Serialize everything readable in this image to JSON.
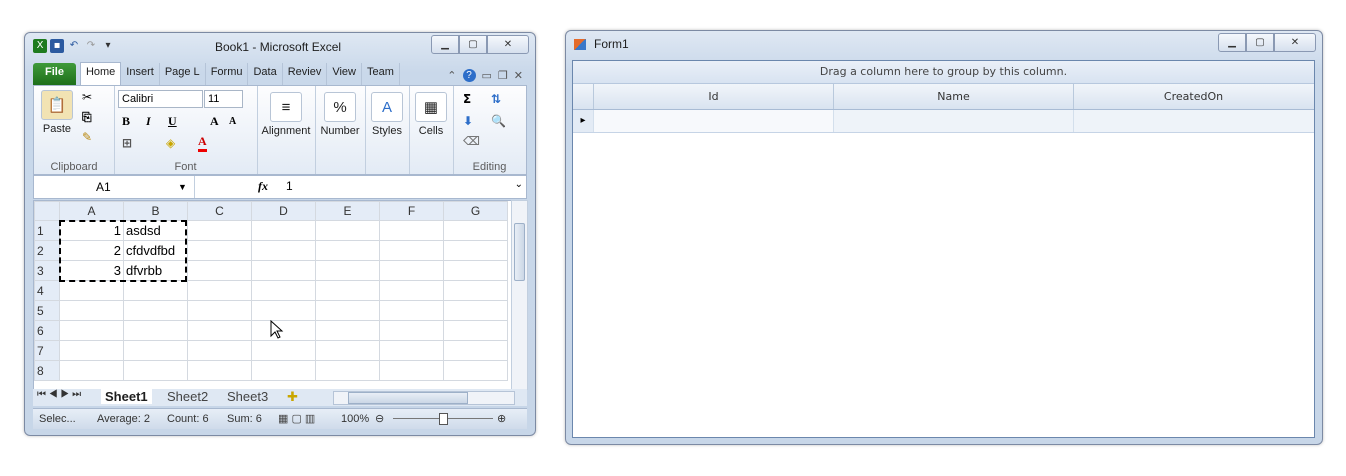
{
  "excel": {
    "title": "Book1  -  Microsoft Excel",
    "file_tab": "File",
    "tabs": [
      "Home",
      "Insert",
      "Page L",
      "Formu",
      "Data",
      "Reviev",
      "View",
      "Team"
    ],
    "clipboard": {
      "paste_label": "Paste",
      "group_label": "Clipboard"
    },
    "font": {
      "name": "Calibri",
      "size": "11",
      "bold": "B",
      "italic": "I",
      "underline": "U",
      "grow": "A",
      "shrink": "A",
      "group_label": "Font"
    },
    "alignment_label": "Alignment",
    "number_label": "Number",
    "styles_label": "Styles",
    "cells_label": "Cells",
    "editing_label": "Editing",
    "name_box": "A1",
    "fx_label": "fx",
    "formula_value": "1",
    "columns": [
      "A",
      "B",
      "C",
      "D",
      "E",
      "F",
      "G"
    ],
    "rows": [
      {
        "num": "1",
        "A": "1",
        "B": "asdsd"
      },
      {
        "num": "2",
        "A": "2",
        "B": "cfdvdfbd"
      },
      {
        "num": "3",
        "A": "3",
        "B": "dfvrbb"
      },
      {
        "num": "4",
        "A": "",
        "B": ""
      },
      {
        "num": "5",
        "A": "",
        "B": ""
      },
      {
        "num": "6",
        "A": "",
        "B": ""
      },
      {
        "num": "7",
        "A": "",
        "B": ""
      },
      {
        "num": "8",
        "A": "",
        "B": ""
      }
    ],
    "sheets": [
      "Sheet1",
      "Sheet2",
      "Sheet3"
    ],
    "status": {
      "mode": "Selec...",
      "average": "Average: 2",
      "count": "Count: 6",
      "sum": "Sum: 6",
      "zoom": "100%"
    }
  },
  "form1": {
    "title": "Form1",
    "group_hint": "Drag a column here to group by this column.",
    "columns": [
      "Id",
      "Name",
      "CreatedOn"
    ],
    "new_row_indicator": "▸"
  },
  "colors": {
    "file_tab": "#2a7d26",
    "selection_dash": "#000000",
    "grid_border": "#6b87ad"
  }
}
